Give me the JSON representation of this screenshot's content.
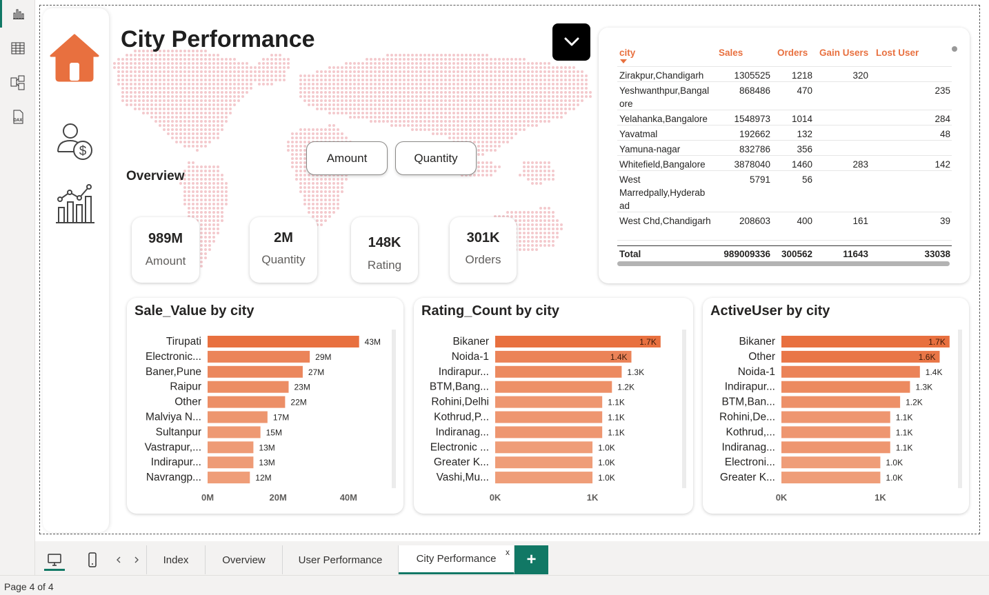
{
  "page": {
    "title": "City Performance",
    "overview_label": "Overview"
  },
  "toggles": {
    "amount": "Amount",
    "quantity": "Quantity"
  },
  "kpis": [
    {
      "value": "989M",
      "label": "Amount"
    },
    {
      "value": "2M",
      "label": "Quantity"
    },
    {
      "value": "148K",
      "label": "Rating"
    },
    {
      "value": "301K",
      "label": "Orders"
    }
  ],
  "table": {
    "headers": [
      "city",
      "Sales",
      "Orders",
      "Gain Users",
      "Lost User"
    ],
    "rows": [
      {
        "city": "Zirakpur,Chandigarh",
        "sales": "1305525",
        "orders": "1218",
        "gain": "320",
        "lost": ""
      },
      {
        "city": "Yeshwanthpur,Bangal ore",
        "sales": "868486",
        "orders": "470",
        "gain": "",
        "lost": "235"
      },
      {
        "city": "Yelahanka,Bangalore",
        "sales": "1548973",
        "orders": "1014",
        "gain": "",
        "lost": "284"
      },
      {
        "city": "Yavatmal",
        "sales": "192662",
        "orders": "132",
        "gain": "",
        "lost": "48"
      },
      {
        "city": "Yamuna-nagar",
        "sales": "832786",
        "orders": "356",
        "gain": "",
        "lost": ""
      },
      {
        "city": "Whitefield,Bangalore",
        "sales": "3878040",
        "orders": "1460",
        "gain": "283",
        "lost": "142"
      },
      {
        "city": "West Marredpally,Hyderab ad",
        "sales": "5791",
        "orders": "56",
        "gain": "",
        "lost": ""
      },
      {
        "city": "West Chd,Chandigarh",
        "sales": "208603",
        "orders": "400",
        "gain": "161",
        "lost": "39"
      }
    ],
    "total": {
      "label": "Total",
      "sales": "989009336",
      "orders": "300562",
      "gain": "11643",
      "lost": "33038"
    }
  },
  "chart_data": [
    {
      "type": "bar",
      "title": "Sale_Value by city",
      "categories": [
        "Tirupati",
        "Electronic...",
        "Baner,Pune",
        "Raipur",
        "Other",
        "Malviya N...",
        "Sultanpur",
        "Vastrapur,...",
        "Indirapur...",
        "Navrangp..."
      ],
      "values": [
        43,
        29,
        27,
        23,
        22,
        17,
        15,
        13,
        13,
        12
      ],
      "data_labels": [
        "43M",
        "29M",
        "27M",
        "23M",
        "22M",
        "17M",
        "15M",
        "13M",
        "13M",
        "12M"
      ],
      "xticks": [
        0,
        20,
        40
      ],
      "xtick_labels": [
        "0M",
        "20M",
        "40M"
      ],
      "xlim": [
        0,
        46
      ],
      "orientation": "horizontal",
      "label_inside": false
    },
    {
      "type": "bar",
      "title": "Rating_Count by city",
      "categories": [
        "Bikaner",
        "Noida-1",
        "Indirapur...",
        "BTM,Bang...",
        "Rohini,Delhi",
        "Kothrud,P...",
        "Indiranag...",
        "Electronic ...",
        "Greater K...",
        "Vashi,Mu..."
      ],
      "values": [
        1.7,
        1.4,
        1.3,
        1.2,
        1.1,
        1.1,
        1.1,
        1.0,
        1.0,
        1.0
      ],
      "data_labels": [
        "1.7K",
        "1.4K",
        "1.3K",
        "1.2K",
        "1.1K",
        "1.1K",
        "1.1K",
        "1.0K",
        "1.0K",
        "1.0K"
      ],
      "xticks": [
        0,
        1
      ],
      "xtick_labels": [
        "0K",
        "1K"
      ],
      "xlim": [
        0,
        1.85
      ],
      "orientation": "horizontal",
      "label_inside": true
    },
    {
      "type": "bar",
      "title": "ActiveUser by city",
      "categories": [
        "Bikaner",
        "Other",
        "Noida-1",
        "Indirapur...",
        "BTM,Ban...",
        "Rohini,De...",
        "Kothrud,...",
        "Indiranag...",
        "Electroni...",
        "Greater K..."
      ],
      "values": [
        1.7,
        1.6,
        1.4,
        1.3,
        1.2,
        1.1,
        1.1,
        1.1,
        1.0,
        1.0
      ],
      "data_labels": [
        "1.7K",
        "1.6K",
        "1.4K",
        "1.3K",
        "1.2K",
        "1.1K",
        "1.1K",
        "1.1K",
        "1.0K",
        "1.0K"
      ],
      "xticks": [
        0,
        1
      ],
      "xtick_labels": [
        "0K",
        "1K"
      ],
      "xlim": [
        0,
        1.75
      ],
      "orientation": "horizontal",
      "label_inside": true
    }
  ],
  "tabs": [
    "Index",
    "Overview",
    "User Performance",
    "City Performance"
  ],
  "active_tab": "City Performance",
  "tab_close": "x",
  "add_tab": "+",
  "status": {
    "page_info": "Page 4 of 4"
  },
  "colors": {
    "accent": "#e8703f",
    "bar_dark": "#e8703f",
    "bar_light": "#f2b597",
    "teal": "#117865"
  }
}
